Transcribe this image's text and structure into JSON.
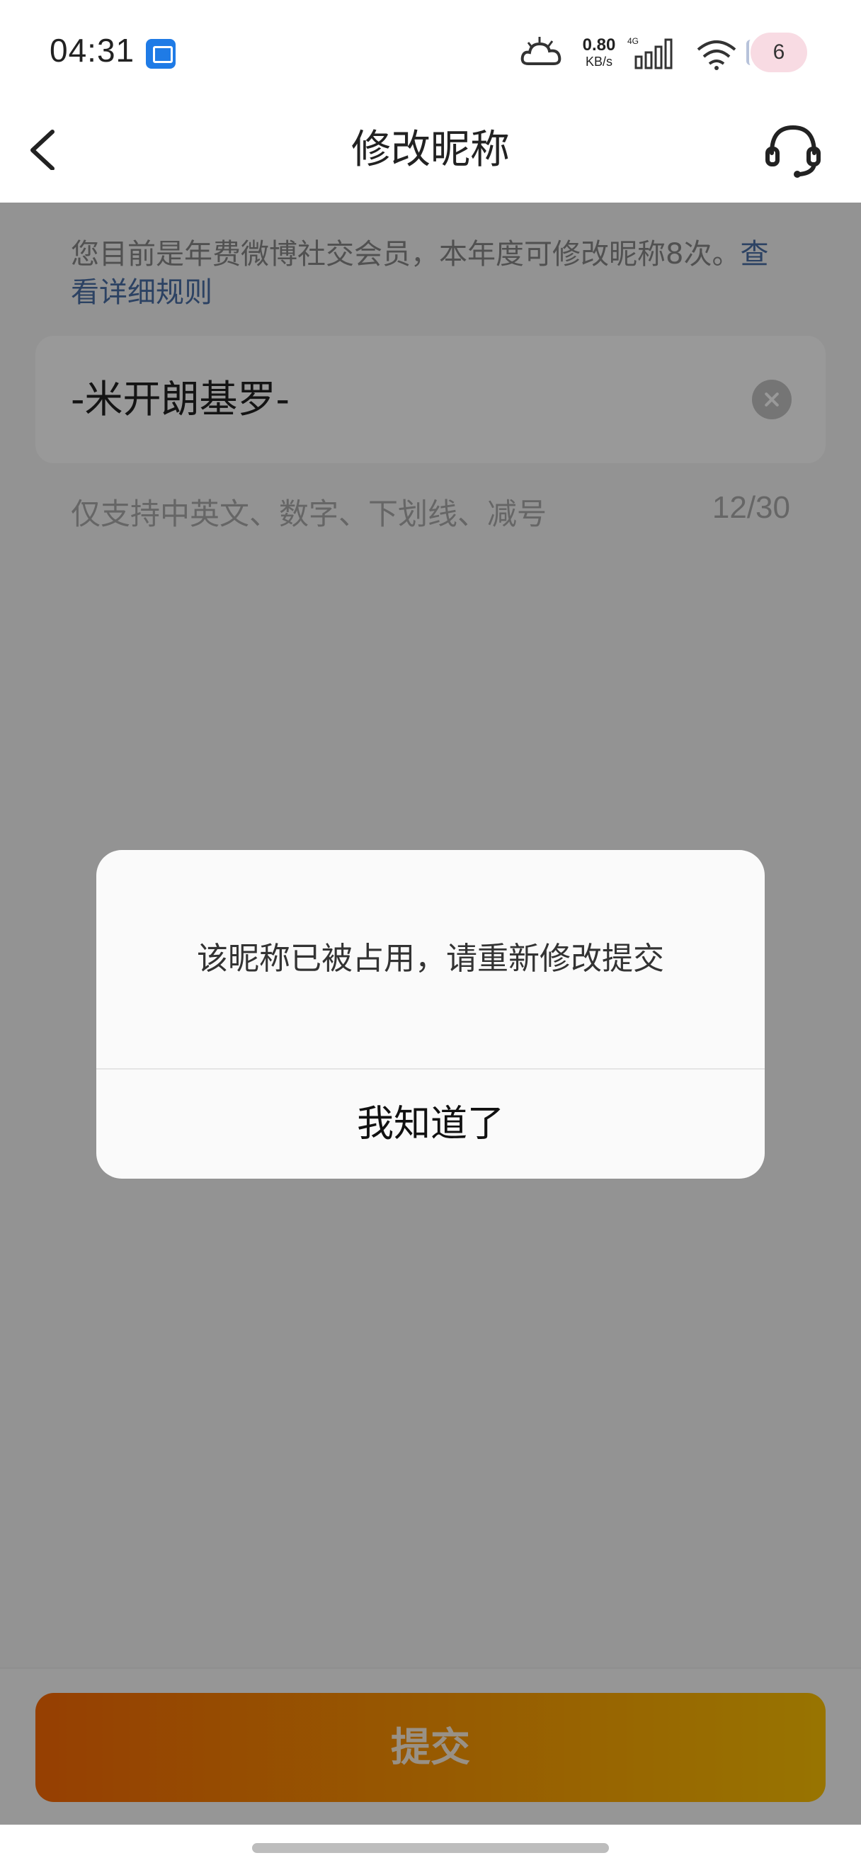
{
  "status_bar": {
    "time": "04:31",
    "net_speed_value": "0.80",
    "net_speed_unit": "KB/s",
    "network_type": "4G",
    "battery_level": "6",
    "icons": [
      "app-notification-icon",
      "weather-icon",
      "signal-icon",
      "wifi-icon",
      "battery-icon"
    ]
  },
  "navbar": {
    "title": "修改昵称",
    "back_icon": "chevron-left-icon",
    "service_icon": "headset-icon"
  },
  "notice": {
    "text": "您目前是年费微博社交会员，本年度可修改昵称8次。",
    "link_text": "查看详细规则"
  },
  "nickname_input": {
    "value": "-米开朗基罗-",
    "clear_icon": "clear-icon"
  },
  "hint": {
    "text": "仅支持中英文、数字、下划线、减号",
    "counter": "12/30"
  },
  "submit": {
    "label": "提交"
  },
  "dialog": {
    "message": "该昵称已被占用，请重新修改提交",
    "confirm_label": "我知道了"
  },
  "colors": {
    "accent_gradient_start": "#fb6a04",
    "accent_gradient_end": "#fec202",
    "link": "#4a6fa5",
    "overlay": "rgba(0,0,0,0.4)"
  }
}
